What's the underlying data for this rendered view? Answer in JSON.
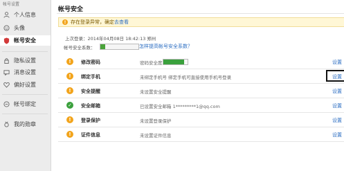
{
  "sidebar": {
    "title": "帐号设置",
    "items": [
      {
        "label": "个人信息",
        "icon": "person-icon",
        "active": false
      },
      {
        "label": "头像",
        "icon": "face-icon",
        "active": false
      },
      {
        "label": "帐号安全",
        "icon": "shield-icon",
        "active": true
      },
      {
        "label": "隐私设置",
        "icon": "lock-icon",
        "active": false
      },
      {
        "label": "消息设置",
        "icon": "message-icon",
        "active": false
      },
      {
        "label": "偏好设置",
        "icon": "heart-icon",
        "active": false
      },
      {
        "label": "帐号绑定",
        "icon": "link-icon",
        "active": false
      },
      {
        "label": "我的勋章",
        "icon": "medal-icon",
        "active": false
      }
    ]
  },
  "main": {
    "title": "帐号安全",
    "warning": {
      "text": "存在登录异常，确定",
      "link": "去查看"
    },
    "last_login": "上次登录：2014年04月08日  18:42:13  郑州",
    "security_coefficient": {
      "label": "帐号安全系数：",
      "level": 0.12,
      "link": "怎样提高帐号安全系数？"
    },
    "rows": [
      {
        "name": "修改密码",
        "desc": "密码安全度",
        "status": "warn",
        "action": "设置",
        "bar": 0.85
      },
      {
        "name": "绑定手机",
        "desc": "未绑定手机号 绑定手机可直接使用手机号登录",
        "status": "warn",
        "action": "设置",
        "highlight": true
      },
      {
        "name": "安全提醒",
        "desc": "未设置安全提醒",
        "status": "warn",
        "action": "设置"
      },
      {
        "name": "安全邮箱",
        "desc": "已设置安全邮箱 1*********1@qq.com",
        "status": "ok",
        "action": "设置"
      },
      {
        "name": "登录保护",
        "desc": "未设置登录保护",
        "status": "warn",
        "action": "设置"
      },
      {
        "name": "证件信息",
        "desc": "未设置证件信息",
        "status": "warn",
        "action": "设置"
      }
    ]
  },
  "colors": {
    "accent_link": "#2c6ec2",
    "warning": "#f2a41b",
    "success": "#3aa03c"
  }
}
